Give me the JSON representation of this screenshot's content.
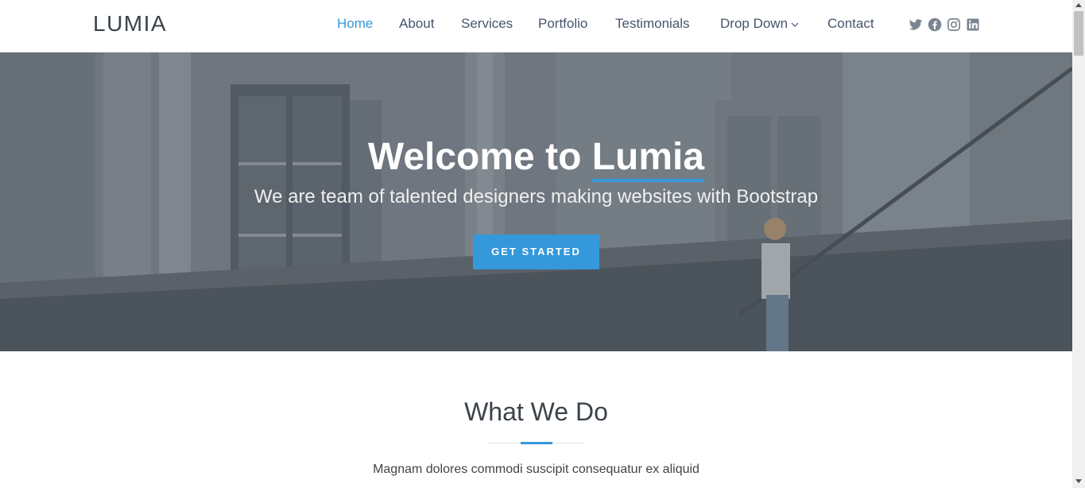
{
  "header": {
    "logo": "LUMIA",
    "nav": [
      {
        "label": "Home",
        "active": true
      },
      {
        "label": "About"
      },
      {
        "label": "Services"
      },
      {
        "label": "Portfolio"
      },
      {
        "label": "Testimonials"
      },
      {
        "label": "Drop Down",
        "has_dropdown": true
      },
      {
        "label": "Contact"
      }
    ],
    "socials": [
      "twitter-icon",
      "facebook-icon",
      "instagram-icon",
      "linkedin-icon"
    ]
  },
  "hero": {
    "title_prefix": "Welcome to ",
    "title_brand": "Lumia",
    "subtitle": "We are team of talented designers making websites with Bootstrap",
    "cta_label": "GET STARTED"
  },
  "section": {
    "title": "What We Do",
    "text": "Magnam dolores commodi suscipit consequatur ex aliquid"
  },
  "colors": {
    "accent": "#3498db",
    "nav_text": "#47536e",
    "logo": "#3b434a"
  }
}
